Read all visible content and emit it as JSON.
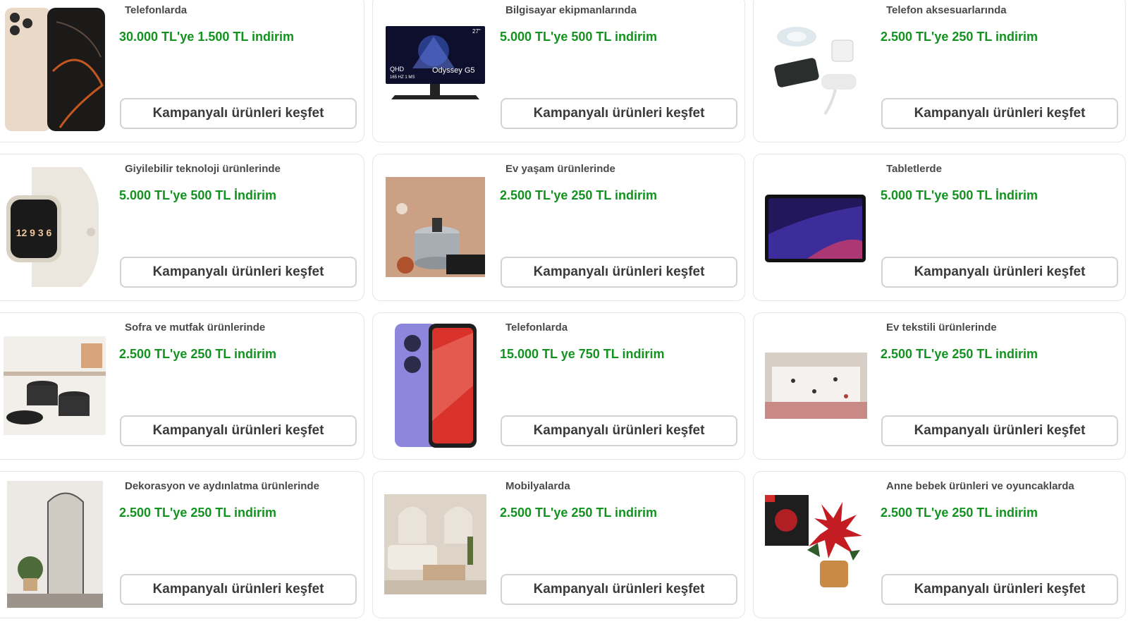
{
  "button_label": "Kampanyalı ürünleri keşfet",
  "cards": [
    {
      "category": "Telefonlarda",
      "deal": "30.000 TL'ye 1.500 TL indirim",
      "image": "smartphone-image"
    },
    {
      "category": "Bilgisayar ekipmanlarında",
      "deal": "5.000 TL'ye 500 TL indirim",
      "image": "monitor-image",
      "monitor_text": {
        "brand": "Odyssey G5",
        "size": "27\"",
        "spec1": "QHD",
        "spec2": "165 HZ 1 MS"
      }
    },
    {
      "category": "Telefon aksesuarlarında",
      "deal": "2.500 TL'ye 250 TL indirim",
      "image": "charger-accessories-image"
    },
    {
      "category": "Giyilebilir teknoloji ürünlerinde",
      "deal": "5.000 TL'ye 500 TL İndirim",
      "image": "smartwatch-image",
      "watch_digits": "12 9 3 6"
    },
    {
      "category": "Ev yaşam ürünlerinde",
      "deal": "2.500 TL'ye 250 TL indirim",
      "image": "pressure-cooker-image"
    },
    {
      "category": "Tabletlerde",
      "deal": "5.000 TL'ye 500 TL İndirim",
      "image": "tablet-image"
    },
    {
      "category": "Sofra ve mutfak ürünlerinde",
      "deal": "2.500 TL'ye 250 TL indirim",
      "image": "cookware-set-image"
    },
    {
      "category": "Telefonlarda",
      "deal": "15.000 TL ye 750 TL indirim",
      "image": "purple-phone-image"
    },
    {
      "category": "Ev tekstili ürünlerinde",
      "deal": "2.500 TL'ye 250 TL indirim",
      "image": "bedding-image"
    },
    {
      "category": "Dekorasyon ve aydınlatma ürünlerinde",
      "deal": "2.500 TL'ye 250 TL indirim",
      "image": "floor-mirror-image"
    },
    {
      "category": "Mobilyalarda",
      "deal": "2.500 TL'ye 250 TL indirim",
      "image": "living-room-image"
    },
    {
      "category": "Anne bebek ürünleri ve oyuncaklarda",
      "deal": "2.500 TL'ye 250 TL indirim",
      "image": "poinsettia-toy-image"
    }
  ],
  "colors": {
    "deal_green": "#12931f",
    "category_text": "#4a4a4a",
    "border": "#e6e6e6"
  }
}
